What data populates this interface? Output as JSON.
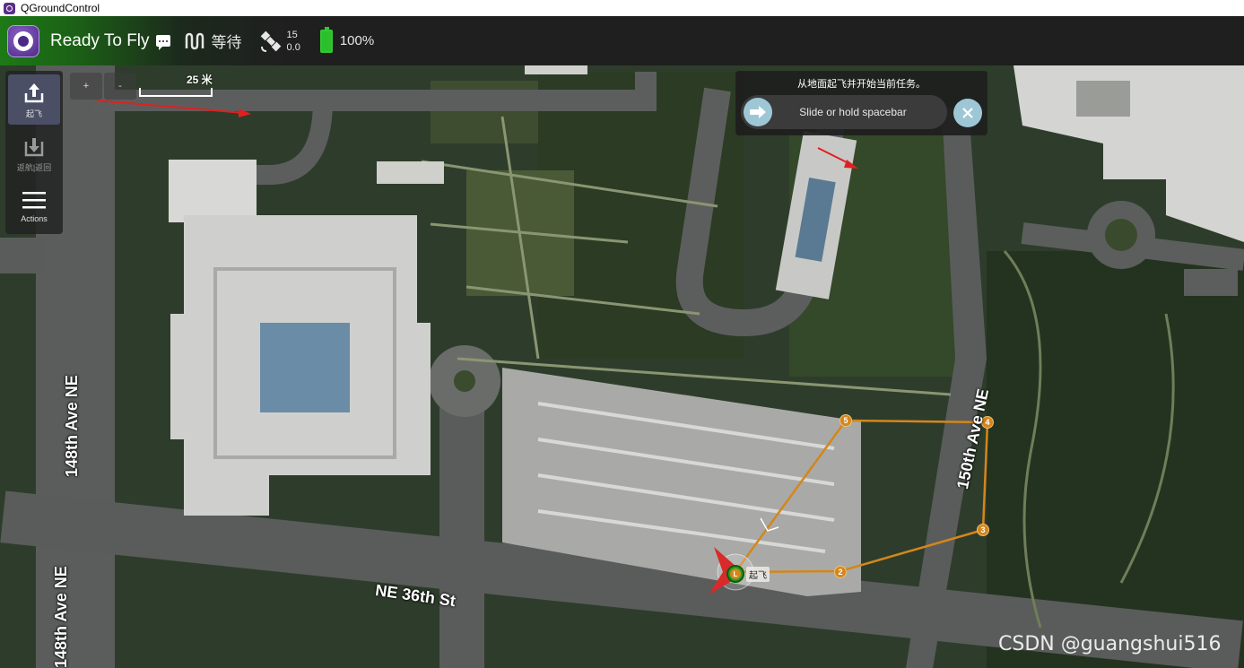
{
  "window": {
    "title": "QGroundControl"
  },
  "toolbar": {
    "flight_status": "Ready To Fly",
    "flight_mode": "等待",
    "gps_satellites": "15",
    "gps_hdop": "0.0",
    "battery_percent": "100%"
  },
  "tools": {
    "takeoff_label": "起飞",
    "rtl_label": "返航|返回",
    "actions_label": "Actions"
  },
  "zoom": {
    "in_label": "+",
    "out_label": "-"
  },
  "scale": {
    "label": "25 米"
  },
  "guided_action": {
    "message": "从地面起飞并开始当前任务。",
    "slider_text": "Slide or hold spacebar"
  },
  "streets": {
    "s148_top": "148th Ave NE",
    "s148_bottom": "148th Ave NE",
    "s150": "150th Ave NE",
    "s36": "NE 36th St"
  },
  "mission": {
    "waypoints": [
      {
        "label": "2"
      },
      {
        "label": "3"
      },
      {
        "label": "4"
      },
      {
        "label": "5"
      }
    ],
    "launch_label": "L",
    "vehicle_label": "起飞"
  },
  "watermark": "CSDN @guangshui516",
  "colors": {
    "toolbar_green": "#1d7a16",
    "mission_line": "#d4861c",
    "battery": "#2bc02b",
    "slider_handle": "#9ec7d6"
  }
}
